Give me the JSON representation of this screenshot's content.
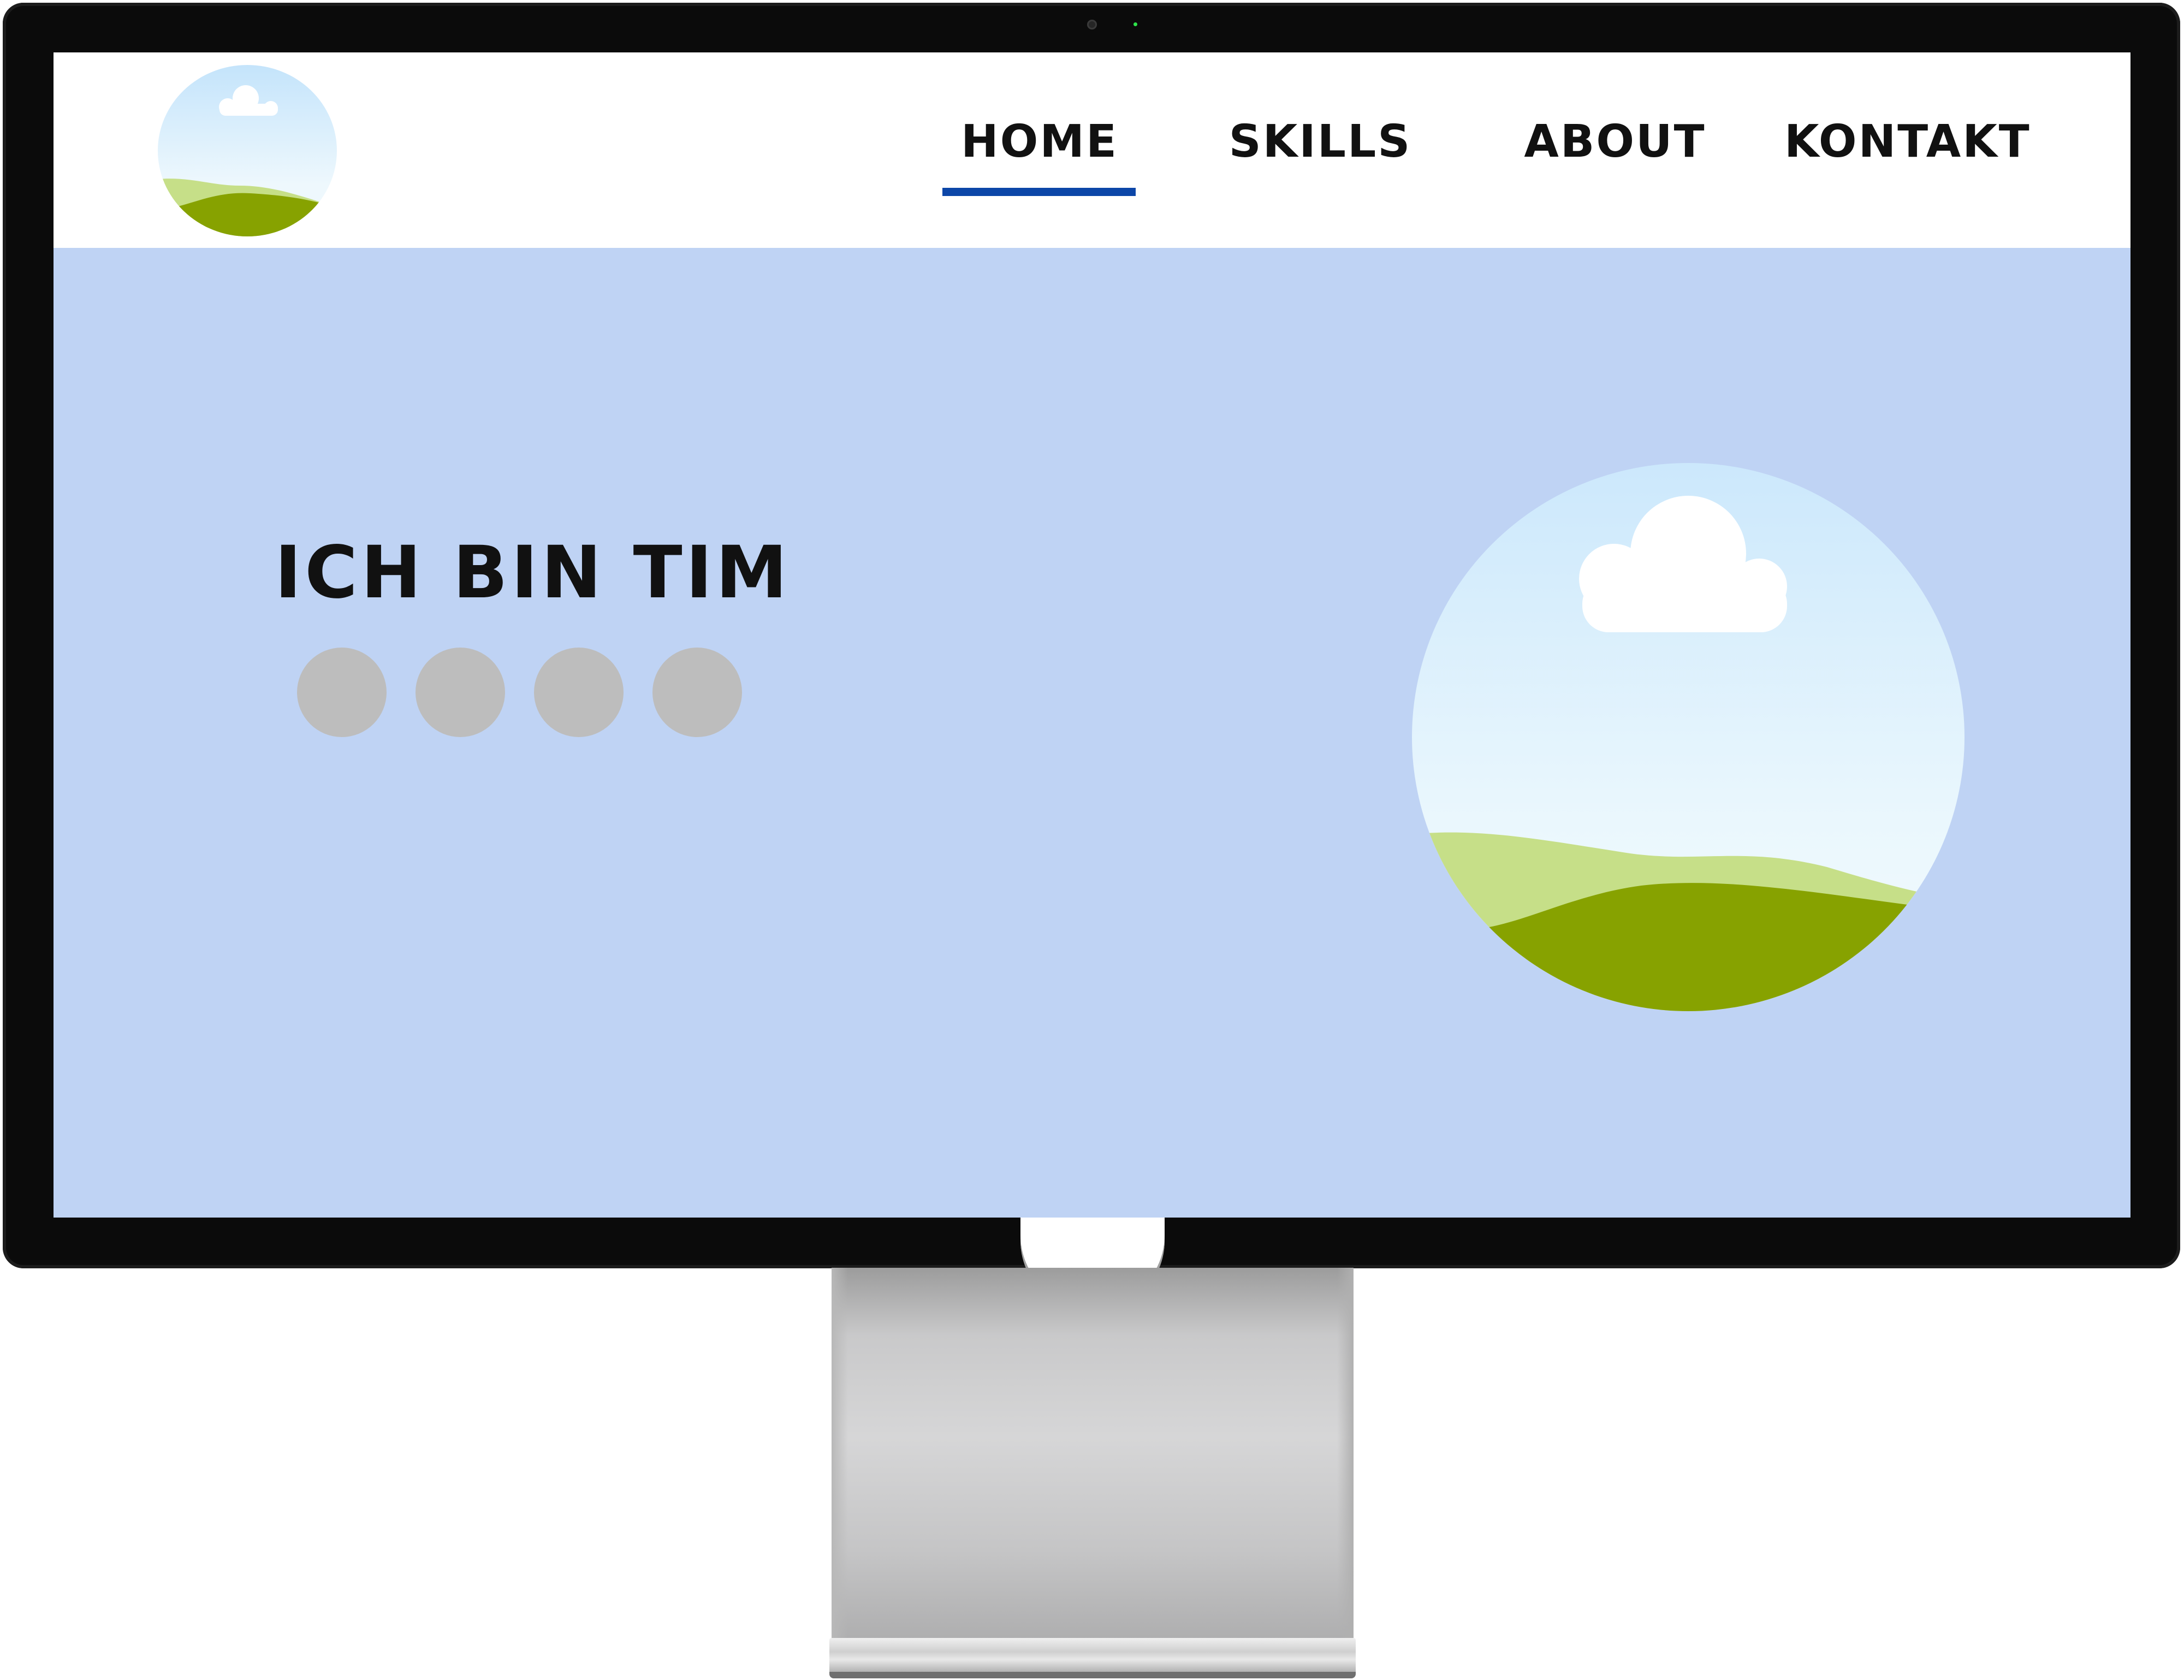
{
  "nav": {
    "items": [
      {
        "label": "HOME",
        "active": true
      },
      {
        "label": "SKILLS",
        "active": false
      },
      {
        "label": "ABOUT",
        "active": false
      },
      {
        "label": "KONTAKT",
        "active": false
      }
    ],
    "active_color": "#0c46a8"
  },
  "logo": {
    "icon": "landscape-icon"
  },
  "hero": {
    "title": "ICH BIN TIM",
    "social_placeholders": [
      {
        "icon": "social-placeholder-icon"
      },
      {
        "icon": "social-placeholder-icon"
      },
      {
        "icon": "social-placeholder-icon"
      },
      {
        "icon": "social-placeholder-icon"
      }
    ],
    "image": {
      "icon": "landscape-illustration"
    }
  },
  "colors": {
    "hero_background": "#bfd3f4",
    "header_background": "#ffffff",
    "placeholder_gray": "#bdbdbd",
    "sky_top": "#cde8fb",
    "hill_light": "#c6df88",
    "hill_dark": "#87a200",
    "bezel": "#0b0b0b"
  }
}
